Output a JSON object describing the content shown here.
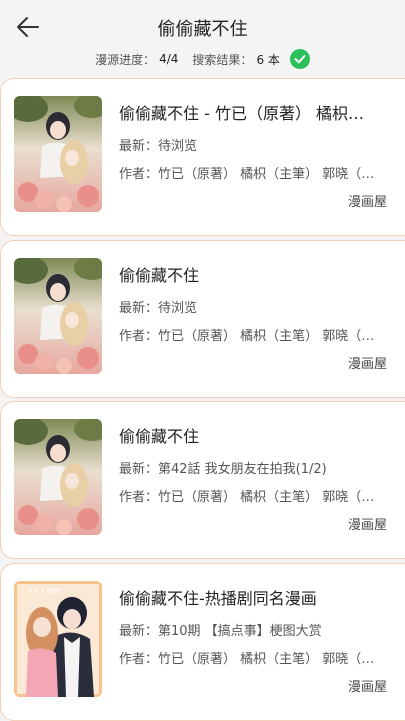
{
  "header": {
    "title": "偷偷藏不住",
    "progress_label": "漫源进度：",
    "progress_value": "4/4",
    "results_label": "搜索结果：",
    "results_value": "6 本"
  },
  "colors": {
    "check": "#2bbf5a",
    "card_border": "#f4cfb7"
  },
  "results": [
    {
      "title": "偷偷藏不住 - 竹已（原著） 橘枳…",
      "latest": "最新：待浏览",
      "author": "作者：竹已（原著） 橘枳（主筆） 郭晓（…",
      "source": "漫画屋"
    },
    {
      "title": "偷偷藏不住",
      "latest": "最新：待浏览",
      "author": "作者：竹已（原著） 橘枳（主笔） 郭晓（…",
      "source": "漫画屋"
    },
    {
      "title": "偷偷藏不住",
      "latest": "最新：第42話 我女朋友在拍我(1/2)",
      "author": "作者：竹已（原著） 橘枳（主笔） 郭晓（…",
      "source": "漫画屋"
    },
    {
      "title": "偷偷藏不住-热播剧同名漫画",
      "latest": "最新：第10期 【搞点事】梗图大赏",
      "author": "作者：竹已（原著） 橘枳（主笔） 郭晓（…",
      "source": "漫画屋"
    }
  ]
}
